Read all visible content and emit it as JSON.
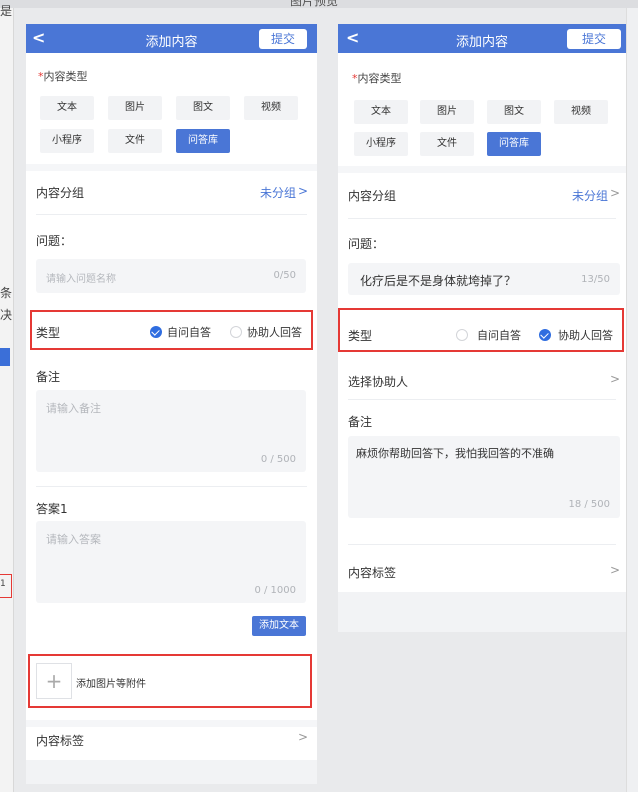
{
  "window": {
    "title": "图片预览"
  },
  "gutter": {
    "chars": [
      "是",
      "条",
      "决",
      "1"
    ]
  },
  "left": {
    "nav": {
      "back": "<",
      "title": "添加内容",
      "submit": "提交"
    },
    "content_type_label": "内容类型",
    "required_mark": "*",
    "types": [
      "文本",
      "图片",
      "图文",
      "视频",
      "小程序",
      "文件",
      "问答库"
    ],
    "active_type": "问答库",
    "group": {
      "label": "内容分组",
      "value": "未分组",
      "chevron": ">"
    },
    "question": {
      "label": "问题：",
      "placeholder": "请输入问题名称",
      "counter": "0/50"
    },
    "answer_type": {
      "label": "类型",
      "option_self": "自问自答",
      "option_assist": "协助人回答",
      "selected": "自问自答"
    },
    "remark": {
      "label": "备注",
      "placeholder": "请输入备注",
      "counter": "0 / 500"
    },
    "answer": {
      "label": "答案1",
      "placeholder": "请输入答案",
      "counter": "0 / 1000",
      "add_text": "添加文本"
    },
    "attachment": {
      "plus": "+",
      "label": "添加图片等附件"
    },
    "tags": {
      "label": "内容标签",
      "chevron": ">"
    }
  },
  "right": {
    "nav": {
      "back": "<",
      "title": "添加内容",
      "submit": "提交"
    },
    "content_type_label": "内容类型",
    "required_mark": "*",
    "types": [
      "文本",
      "图片",
      "图文",
      "视频",
      "小程序",
      "文件",
      "问答库"
    ],
    "active_type": "问答库",
    "group": {
      "label": "内容分组",
      "value": "未分组",
      "chevron": ">"
    },
    "question": {
      "label": "问题：",
      "value": "化疗后是不是身体就垮掉了？",
      "counter": "13/50"
    },
    "answer_type": {
      "label": "类型",
      "option_self": "自问自答",
      "option_assist": "协助人回答",
      "selected": "协助人回答"
    },
    "helper": {
      "label": "选择协助人",
      "chevron": ">"
    },
    "remark": {
      "label": "备注",
      "value": "麻烦你帮助回答下，我怕我回答的不准确",
      "counter": "18 / 500"
    },
    "tags": {
      "label": "内容标签",
      "chevron": ">"
    }
  },
  "colors": {
    "brand": "#4a76d6",
    "highlight_border": "#e53935",
    "radio_on": "#2f6de0"
  }
}
